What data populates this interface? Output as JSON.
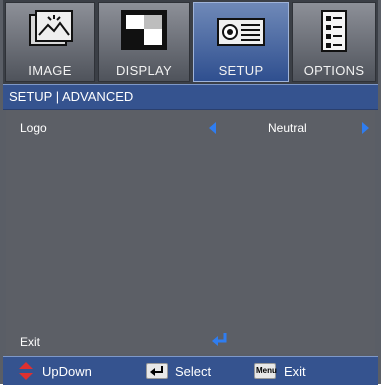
{
  "tabs": [
    {
      "label": "IMAGE",
      "icon": "image-icon",
      "active": false
    },
    {
      "label": "DISPLAY",
      "icon": "display-icon",
      "active": false
    },
    {
      "label": "SETUP",
      "icon": "projector-icon",
      "active": true
    },
    {
      "label": "OPTIONS",
      "icon": "options-icon",
      "active": false
    }
  ],
  "header": {
    "title": "SETUP | ADVANCED"
  },
  "menu": {
    "logo": {
      "label": "Logo",
      "value": "Neutral"
    },
    "exit": {
      "label": "Exit"
    }
  },
  "footer": {
    "updown": "UpDown",
    "select": "Select",
    "menu_key": "Menu",
    "exit": "Exit"
  },
  "colors": {
    "accent": "#2f7df0",
    "header": "#35538f",
    "panel": "#5c5f66"
  }
}
